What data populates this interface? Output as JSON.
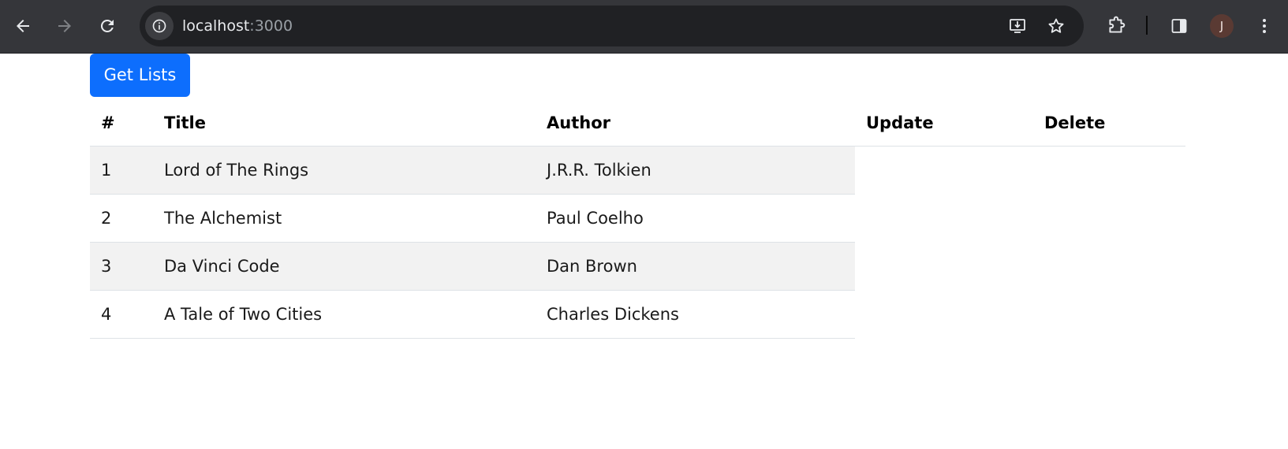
{
  "browser": {
    "url_host": "localhost",
    "url_port": ":3000",
    "profile_initial": "J"
  },
  "page": {
    "get_lists_label": "Get Lists",
    "table": {
      "headers": [
        "#",
        "Title",
        "Author",
        "Update",
        "Delete"
      ],
      "rows": [
        {
          "num": "1",
          "title": "Lord of The Rings",
          "author": "J.R.R. Tolkien"
        },
        {
          "num": "2",
          "title": "The Alchemist",
          "author": "Paul Coelho"
        },
        {
          "num": "3",
          "title": "Da Vinci Code",
          "author": "Dan Brown"
        },
        {
          "num": "4",
          "title": "A Tale of Two Cities",
          "author": "Charles Dickens"
        }
      ]
    }
  },
  "colors": {
    "primary_button": "#0d6efd",
    "stripe": "#f2f2f2",
    "chrome_bg": "#35363a"
  }
}
